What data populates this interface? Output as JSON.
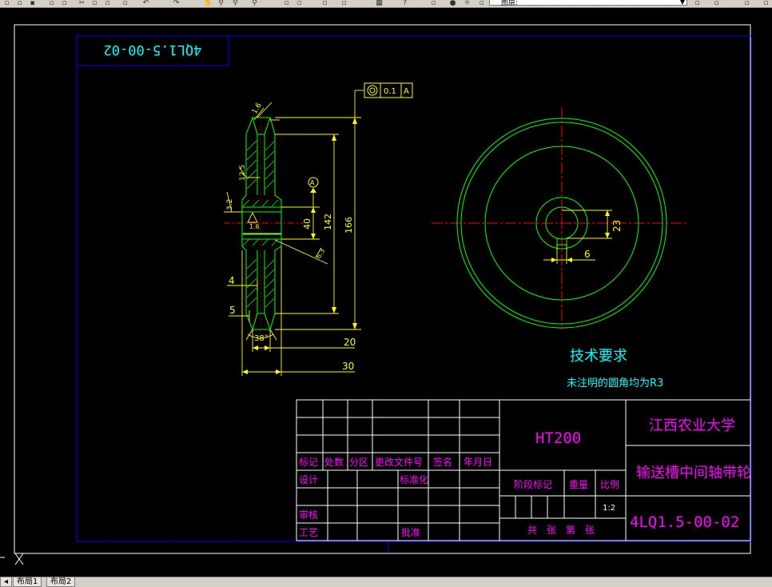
{
  "toolbar": {
    "layer_value": "图层:",
    "icons": [
      "new-icon",
      "open-icon",
      "save-icon",
      "print-icon",
      "preview-icon",
      "cut-icon",
      "copy-icon",
      "paste-icon",
      "match-icon",
      "undo-icon",
      "redo-icon",
      "pan-icon",
      "zoom-realtime-icon",
      "zoom-window-icon",
      "zoom-previous-icon",
      "properties-icon",
      "designcenter-icon",
      "toolpalette-icon",
      "calculator-icon",
      "help-icon",
      "layer-state-icon",
      "lightbulb-icon",
      "sun-icon",
      "lock-icon",
      "color-icon"
    ]
  },
  "drawing": {
    "code_mirrored": "4QL1.5-00-02",
    "tech_title": "技术要求",
    "tech_note": "未注明的圆角均为R3",
    "dims": {
      "runout_symbol": "◎",
      "runout_value": "0.1",
      "runout_datum": "A",
      "rough_top": "1.6",
      "rough_side": "12.5",
      "rough_left": "3.2",
      "rough_bore": "1.6",
      "rough_slant": "6.3",
      "datum": "A",
      "d40": "40",
      "d142": "142",
      "d166": "166",
      "d4": "4",
      "d5": "5",
      "angle38": "38°",
      "d20": "20",
      "d30": "30",
      "key23": "23",
      "key6": "6"
    },
    "title_block": {
      "material": "HT200",
      "university": "江西农业大学",
      "part_name": "输送槽中间轴带轮",
      "code": "4LQ1.5-00-02",
      "scale": "1:2",
      "labels": {
        "mark": "标记",
        "count": "处数",
        "zone": "分区",
        "change_doc": "更改文件号",
        "sign": "签名",
        "date": "年月日",
        "design": "设计",
        "standardize": "标准化",
        "stage_mark": "阶段标记",
        "weight": "重量",
        "scale_label": "比例",
        "review": "审核",
        "process": "工艺",
        "approve": "批准",
        "sheets": "共　张　第　张"
      }
    }
  },
  "tabs": {
    "layout1": "布局1",
    "layout2": "布局2"
  },
  "colors": {
    "background": "#000000",
    "frame": "#0000ff",
    "part": "#00ff00",
    "dimension": "#ffff00",
    "centerline": "#ff0000",
    "annotation": "#ff00ff",
    "text": "#00ffff",
    "table": "#ffffff"
  }
}
